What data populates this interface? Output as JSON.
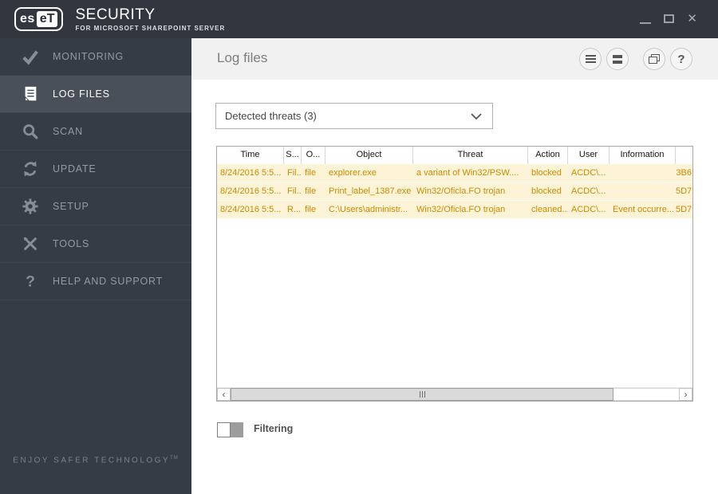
{
  "titlebar": {
    "logo_left": "es",
    "logo_right": "eT",
    "product": "SECURITY",
    "edition": "FOR MICROSOFT SHAREPOINT SERVER",
    "close_glyph": "✕"
  },
  "sidebar": {
    "items": [
      {
        "label": "MONITORING",
        "icon": "check-icon",
        "active": false
      },
      {
        "label": "LOG FILES",
        "icon": "log-document-icon",
        "active": true
      },
      {
        "label": "SCAN",
        "icon": "magnifier-icon",
        "active": false
      },
      {
        "label": "UPDATE",
        "icon": "refresh-icon",
        "active": false
      },
      {
        "label": "SETUP",
        "icon": "gear-icon",
        "active": false
      },
      {
        "label": "TOOLS",
        "icon": "tools-icon",
        "active": false
      },
      {
        "label": "HELP AND SUPPORT",
        "icon": "question-icon",
        "active": false
      }
    ],
    "tagline": "ENJOY SAFER TECHNOLOGY",
    "tagline_tm": "TM"
  },
  "header": {
    "title": "Log files",
    "buttons": [
      {
        "name": "menu-lines"
      },
      {
        "name": "menu-bars"
      },
      {
        "name": "cascade-windows"
      },
      {
        "name": "help",
        "glyph": "?"
      }
    ]
  },
  "filter_dropdown": {
    "value": "Detected threats (3)"
  },
  "table": {
    "columns": [
      {
        "label": "Time"
      },
      {
        "label": "S..."
      },
      {
        "label": "O..."
      },
      {
        "label": "Object"
      },
      {
        "label": "Threat"
      },
      {
        "label": "Action"
      },
      {
        "label": "User"
      },
      {
        "label": "Information"
      },
      {
        "label": ""
      }
    ],
    "rows": [
      {
        "time": "8/24/2016 5:5...",
        "scanner": "Fil...",
        "occurred": "file",
        "object": "explorer.exe",
        "threat": "a variant of Win32/PSW....",
        "action": "blocked",
        "user": "ACDC\\...",
        "information": "",
        "hash": "3B6"
      },
      {
        "time": "8/24/2016 5:5...",
        "scanner": "Fil...",
        "occurred": "file",
        "object": "Print_label_1387.exe",
        "threat": "Win32/Oficla.FO trojan",
        "action": "blocked",
        "user": "ACDC\\...",
        "information": "",
        "hash": "5D7"
      },
      {
        "time": "8/24/2016 5:5...",
        "scanner": "R...",
        "occurred": "file",
        "object": "C:\\Users\\administr...",
        "threat": "Win32/Oficla.FO trojan",
        "action": "cleaned...",
        "user": "ACDC\\...",
        "information": "Event occurre...",
        "hash": "5D7"
      }
    ]
  },
  "scrollbar": {
    "left_glyph": "‹",
    "right_glyph": "›"
  },
  "filtering": {
    "label": "Filtering",
    "enabled": false
  },
  "colors": {
    "topbar_bg": "#31363f",
    "sidebar_bg": "#363c46",
    "active_item_bg": "#4a505a",
    "header_strip_bg": "#f1f1f1",
    "threat_row_bg": "#fdf3d6",
    "threat_row_text": "#c98b00"
  }
}
